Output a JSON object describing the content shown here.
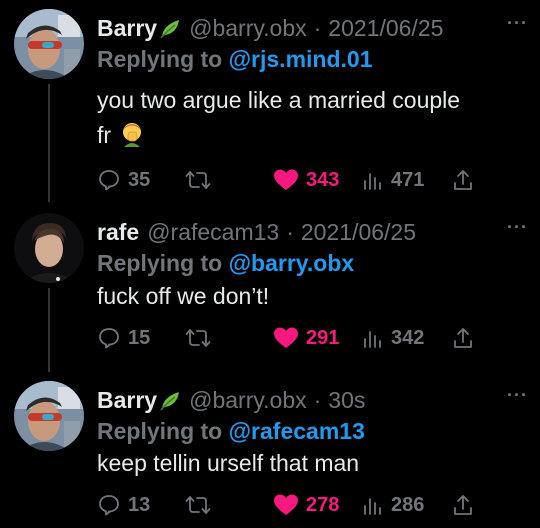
{
  "tweets": [
    {
      "author_name": "Barry",
      "handle": "@barry.obx",
      "separator": "·",
      "timestamp": "2021/06/25",
      "replying_prefix": "Replying to",
      "replying_handle": "@rjs.mind.01",
      "text_lines": [
        "you two argue like a married couple",
        "fr"
      ],
      "emoji": "man-facepalming-emoji",
      "replies": "35",
      "likes": "343",
      "views": "471",
      "has_leaf_badge": true,
      "avatar": "barry-avatar"
    },
    {
      "author_name": "rafe",
      "handle": "@rafecam13",
      "separator": "·",
      "timestamp": "2021/06/25",
      "replying_prefix": "Replying to",
      "replying_handle": "@barry.obx",
      "text_lines": [
        "fuck off we don’t!"
      ],
      "replies": "15",
      "likes": "291",
      "views": "342",
      "has_leaf_badge": false,
      "avatar": "rafe-avatar"
    },
    {
      "author_name": "Barry",
      "handle": "@barry.obx",
      "separator": "·",
      "timestamp": "30s",
      "replying_prefix": "Replying to",
      "replying_handle": "@rafecam13",
      "text_lines": [
        "keep tellin urself that man"
      ],
      "replies": "13",
      "likes": "278",
      "views": "286",
      "has_leaf_badge": true,
      "avatar": "barry-avatar"
    }
  ],
  "colors": {
    "background": "#000000",
    "text": "#e7e9ea",
    "muted": "#71767b",
    "link": "#1d9bf0",
    "like": "#f91880",
    "thread_line": "#333639",
    "leaf": "#6bbf3a"
  }
}
